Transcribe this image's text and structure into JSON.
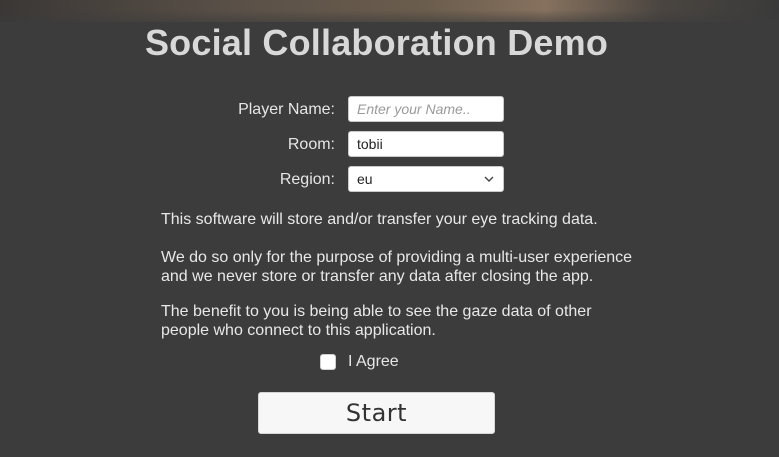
{
  "title": "Social Collaboration Demo",
  "form": {
    "player_name": {
      "label": "Player Name:",
      "value": "",
      "placeholder": "Enter your Name.."
    },
    "room": {
      "label": "Room:",
      "value": "tobii"
    },
    "region": {
      "label": "Region:",
      "selected": "eu"
    }
  },
  "notice": {
    "paragraph1": "This software will store and/or transfer your eye tracking data.",
    "paragraph2_line1": "We do so only for the purpose of providing a multi-user experience",
    "paragraph2_line2": "and we never store or transfer any data after closing the app.",
    "paragraph3_line1": "The benefit to you is being able to see the gaze data of other",
    "paragraph3_line2": "people who connect to this application."
  },
  "agree": {
    "label": "I Agree",
    "checked": false
  },
  "start_button": {
    "label": "Start"
  },
  "icons": {
    "region_dropdown": "chevron-down-icon"
  },
  "colors": {
    "background": "#3c3c3c",
    "title": "#d8d8d8",
    "text": "#e8e8e8",
    "input_bg": "#ffffff",
    "button_bg": "#f7f7f7"
  }
}
